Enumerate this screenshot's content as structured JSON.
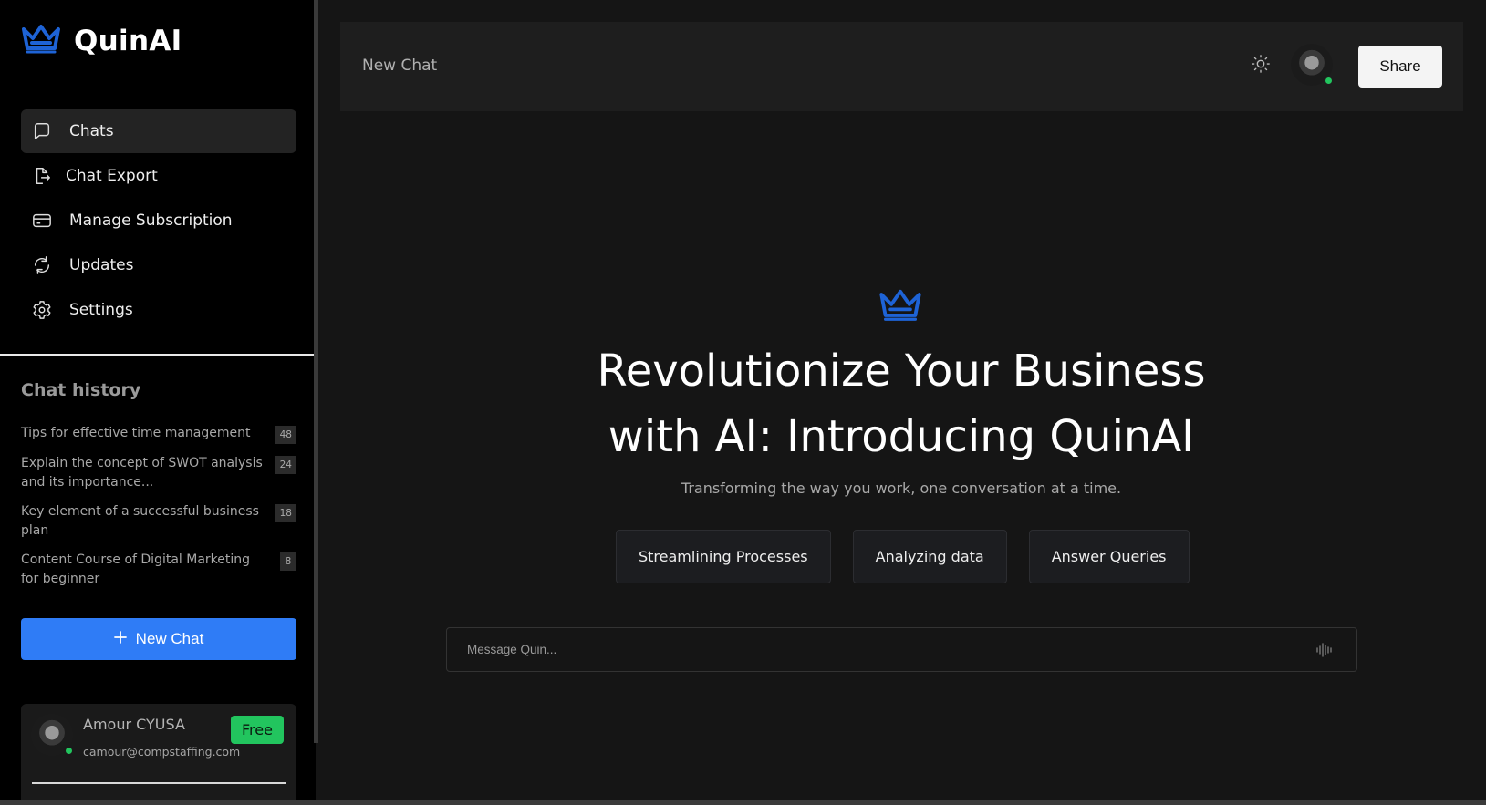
{
  "brand": {
    "name": "QuinAI",
    "accent_color": "#1e63d6"
  },
  "nav": {
    "items": [
      {
        "label": "Chats",
        "icon": "chat-bubble-icon",
        "active": true
      },
      {
        "label": "Chat Export",
        "icon": "file-export-icon",
        "active": false
      },
      {
        "label": "Manage Subscription",
        "icon": "credit-card-icon",
        "active": false
      },
      {
        "label": "Updates",
        "icon": "refresh-icon",
        "active": false
      },
      {
        "label": "Settings",
        "icon": "gear-icon",
        "active": false
      }
    ]
  },
  "history": {
    "title": "Chat history",
    "items": [
      {
        "text": "Tips for effective time management",
        "count": "48"
      },
      {
        "text": "Explain the concept of SWOT analysis and its importance...",
        "count": "24"
      },
      {
        "text": "Key element of a successful business plan",
        "count": "18"
      },
      {
        "text": "Content Course of Digital Marketing for beginner",
        "count": "8"
      }
    ]
  },
  "new_chat_button": {
    "label": "New Chat"
  },
  "user": {
    "name": "Amour CYUSA",
    "email": "camour@compstaffing.com",
    "plan": "Free",
    "status_color": "#22c55e"
  },
  "topbar": {
    "title": "New Chat",
    "share_label": "Share"
  },
  "hero": {
    "title_line1": "Revolutionize Your Business",
    "title_line2": "with AI: Introducing QuinAI",
    "subtitle": "Transforming the way you work, one conversation at a time."
  },
  "suggestions": [
    "Streamlining Processes",
    "Analyzing data",
    "Answer Queries"
  ],
  "composer": {
    "placeholder": "Message Quin..."
  },
  "colors": {
    "primary_button": "#2f7cf6",
    "badge_free": "#22c55e"
  }
}
